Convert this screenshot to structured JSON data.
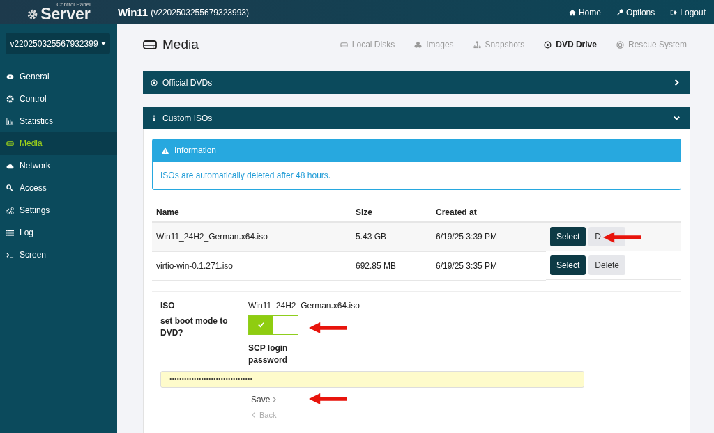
{
  "logo": {
    "small": "Control Panel",
    "big": "Server"
  },
  "header": {
    "title": "Win11",
    "subtitle": "(v2202503255679323993)",
    "links": [
      "Home",
      "Options",
      "Logout"
    ]
  },
  "server_select": {
    "value": "v220250325567932399"
  },
  "sidebar": {
    "items": [
      {
        "label": "General",
        "selected": false
      },
      {
        "label": "Control",
        "selected": false
      },
      {
        "label": "Statistics",
        "selected": false
      },
      {
        "label": "Media",
        "selected": true
      },
      {
        "label": "Network",
        "selected": false
      },
      {
        "label": "Access",
        "selected": false
      },
      {
        "label": "Settings",
        "selected": false
      },
      {
        "label": "Log",
        "selected": false
      },
      {
        "label": "Screen",
        "selected": false
      }
    ]
  },
  "page": {
    "title": "Media"
  },
  "tabs": [
    {
      "label": "Local Disks",
      "selected": false
    },
    {
      "label": "Images",
      "selected": false
    },
    {
      "label": "Snapshots",
      "selected": false
    },
    {
      "label": "DVD Drive",
      "selected": true
    },
    {
      "label": "Rescue System",
      "selected": false
    }
  ],
  "panels": [
    {
      "title": "Official DVDs",
      "expanded": false
    },
    {
      "title": "Custom ISOs",
      "expanded": true
    }
  ],
  "info": {
    "title": "Information",
    "text": "ISOs are automatically deleted after 48 hours."
  },
  "table": {
    "columns": [
      "Name",
      "Size",
      "Created at"
    ],
    "rows": [
      {
        "name": "Win11_24H2_German.x64.iso",
        "size": "5.43 GB",
        "created": "6/19/25 3:39 PM",
        "select": "Select",
        "delete": "D",
        "selected": true
      },
      {
        "name": "virtio-win-0.1.271.iso",
        "size": "692.85 MB",
        "created": "6/19/25 3:35 PM",
        "select": "Select",
        "delete": "Delete",
        "selected": false
      }
    ]
  },
  "form": {
    "iso_label": "ISO",
    "iso_value": "Win11_24H2_German.x64.iso",
    "boot_label": "set boot mode to DVD?",
    "boot_on": true,
    "password_label": "SCP login password",
    "password_value": "••••••••••••••••••••••••••••••••••",
    "save": "Save",
    "back": "Back"
  }
}
